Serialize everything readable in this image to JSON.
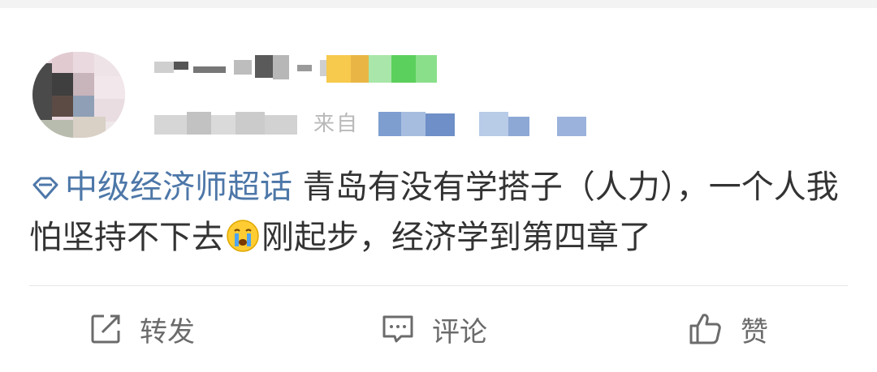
{
  "post": {
    "topic": "中级经济师超话",
    "body_part1": "青岛有没有学搭子（人力），一个人我怕坚持不下去",
    "body_part2": "刚起步，经济学到第四章了",
    "emoji": "crying-face-emoji"
  },
  "meta": {
    "source_prefix": "来自"
  },
  "actions": {
    "repost_label": "转发",
    "comment_label": "评论",
    "like_label": "赞"
  },
  "colors": {
    "topic": "#4d77a8",
    "text": "#333333",
    "muted": "#6b6b6b"
  },
  "icons": [
    "diamond-topic-icon",
    "share-icon",
    "comment-icon",
    "thumbs-up-icon"
  ]
}
